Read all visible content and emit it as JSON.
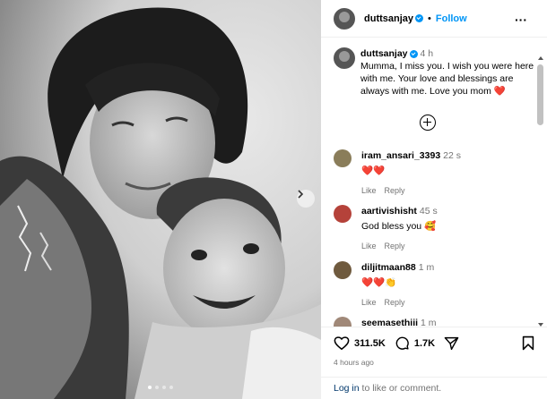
{
  "post": {
    "username": "duttsanjay",
    "follow_separator": "•",
    "follow_label": "Follow",
    "more_icon": "more-horizontal-icon",
    "caption": {
      "username": "duttsanjay",
      "time": "4 h",
      "text": "Mumma, I miss you. I wish you were here with me. Your love and blessings are always with me. Love you mom ❤️"
    },
    "likes": "311.5K",
    "comments_count": "1.7K",
    "posted": "4 hours ago"
  },
  "comments": [
    {
      "username": "iram_ansari_3393",
      "time": "22 s",
      "text": "❤️❤️",
      "like": "Like",
      "reply": "Reply",
      "avatar_color": "#8a7d5a"
    },
    {
      "username": "aartivishisht",
      "time": "45 s",
      "text": "God bless you 🥰",
      "like": "Like",
      "reply": "Reply",
      "avatar_color": "#b5423a"
    },
    {
      "username": "diljitmaan88",
      "time": "1 m",
      "text": "❤️❤️👏",
      "like": "Like",
      "reply": "Reply",
      "avatar_color": "#6f5a3e"
    },
    {
      "username": "seemasethiii",
      "time": "1 m",
      "text": "",
      "like": "",
      "reply": "",
      "avatar_color": "#a08878"
    }
  ],
  "footer": {
    "login_link": "Log in",
    "login_rest": " to like or comment."
  },
  "carousel": {
    "total": 4,
    "active": 0
  },
  "colors": {
    "accent": "#0095f6",
    "heart": "#ff3040",
    "muted": "#737373"
  }
}
